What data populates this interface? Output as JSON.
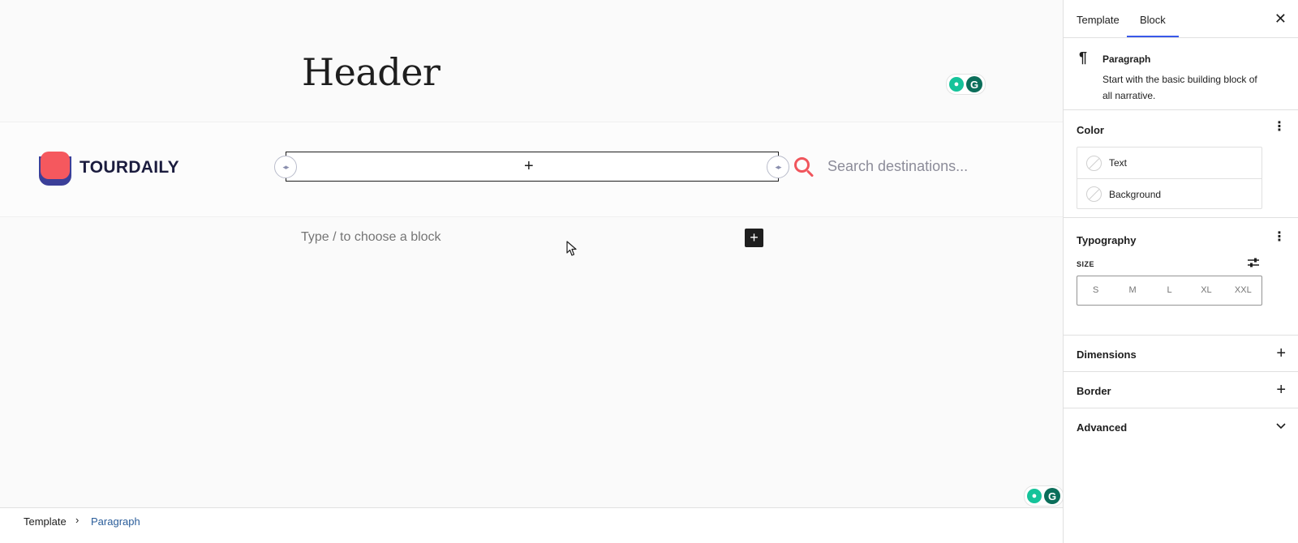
{
  "canvas": {
    "header_title": "Header",
    "logo_text": "TOURDAILY",
    "search_placeholder": "Search destinations...",
    "block_placeholder": "Type / to choose a block",
    "nav_plus": "+",
    "inserter_plus": "+"
  },
  "sidebar": {
    "tabs": [
      {
        "label": "Template",
        "active": false
      },
      {
        "label": "Block",
        "active": true
      }
    ],
    "close": "✕",
    "block": {
      "title": "Paragraph",
      "description": "Start with the basic building block of all narrative."
    },
    "color": {
      "title": "Color",
      "items": [
        "Text",
        "Background"
      ]
    },
    "typography": {
      "title": "Typography",
      "size_label": "SIZE",
      "sizes": [
        "S",
        "M",
        "L",
        "XL",
        "XXL"
      ]
    },
    "dimensions": {
      "title": "Dimensions"
    },
    "border": {
      "title": "Border"
    },
    "advanced": {
      "title": "Advanced"
    }
  },
  "breadcrumb": {
    "items": [
      "Template",
      "Paragraph"
    ]
  },
  "colors": {
    "accent": "#3858e9",
    "logo_red": "#f5585e",
    "logo_navy": "#3b3f99",
    "search_red": "#f0555c"
  }
}
